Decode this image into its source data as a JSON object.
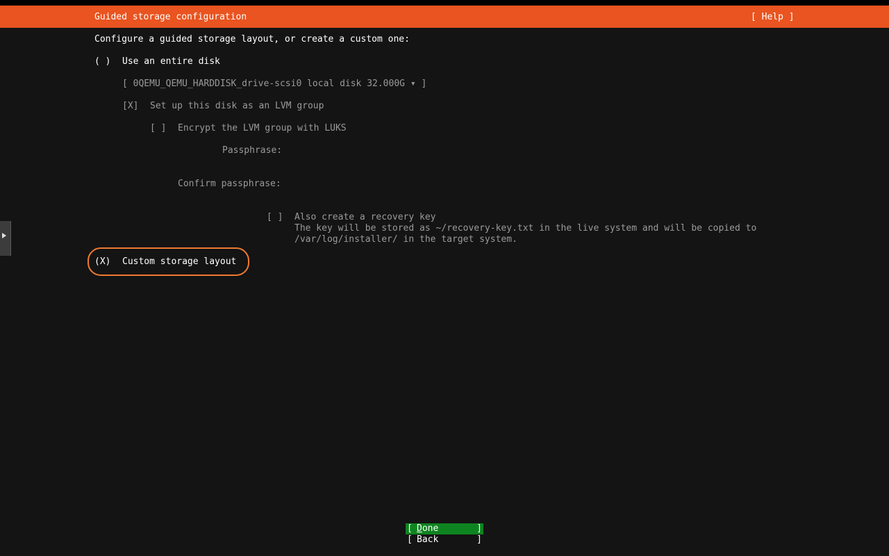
{
  "header": {
    "title": "Guided storage configuration",
    "help_label": "[ Help ]"
  },
  "intro": "Configure a guided storage layout, or create a custom one:",
  "entire_disk": {
    "radio": "( )",
    "label": "Use an entire disk",
    "disk_selector": "[ 0QEMU_QEMU_HARDDISK_drive-scsi0 local disk 32.000G ▾ ]",
    "lvm_checkbox": "[X]",
    "lvm_label": "Set up this disk as an LVM group",
    "encrypt_checkbox": "[ ]",
    "encrypt_label": "Encrypt the LVM group with LUKS",
    "passphrase_label": "Passphrase:",
    "confirm_passphrase_label": "Confirm passphrase:",
    "recovery_checkbox": "[ ]",
    "recovery_label": "Also create a recovery key",
    "recovery_note_1": "The key will be stored as ~/recovery-key.txt in the live system and will be copied to",
    "recovery_note_2": "/var/log/installer/ in the target system."
  },
  "custom_layout": {
    "radio": "(X)",
    "label": "Custom storage layout"
  },
  "buttons": {
    "done": {
      "open": "[",
      "first": "D",
      "rest": "one",
      "close": "]"
    },
    "back": {
      "open": "[",
      "label": "Back",
      "close": "]"
    }
  },
  "colors": {
    "header_bg": "#e95420",
    "done_bg": "#0e8420",
    "highlight_ring": "#f07a30",
    "background": "#141414",
    "dim_text": "#9a9a9a"
  },
  "icons": {
    "side_tab": "triangle-right-icon",
    "dropdown": "down-triangle-icon"
  }
}
